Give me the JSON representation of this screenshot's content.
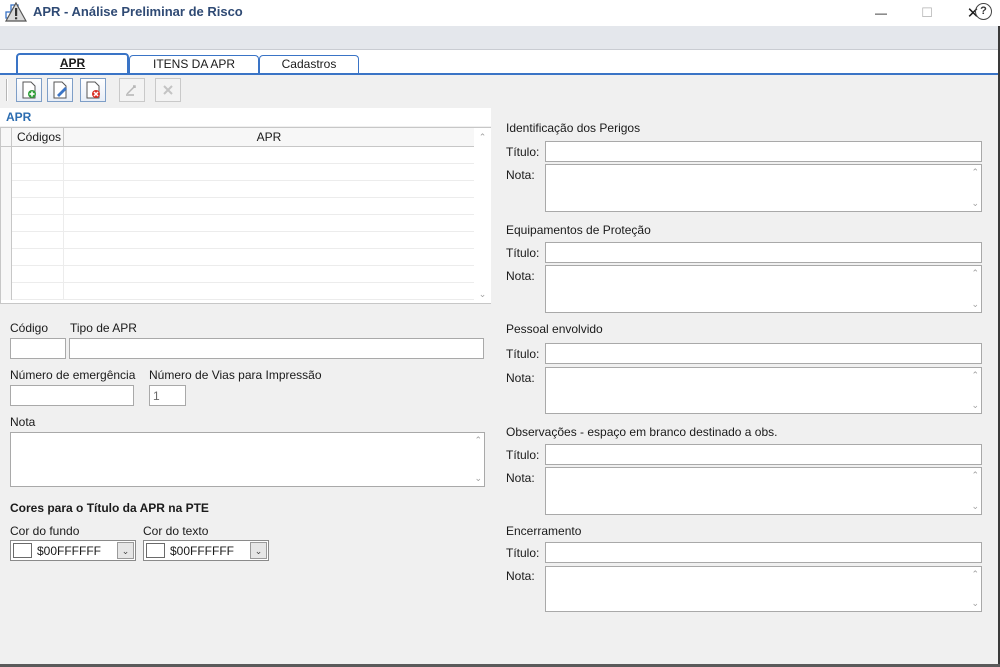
{
  "window": {
    "minimize_glyph": "—",
    "maximize_glyph": "☐",
    "close_glyph": "✕"
  },
  "header": {
    "title": "APR - Análise Preliminar de Risco",
    "help_glyph": "?"
  },
  "tabs": [
    {
      "label": "APR",
      "active": true
    },
    {
      "label": "ITENS DA APR",
      "active": false
    },
    {
      "label": "Cadastros",
      "active": false
    }
  ],
  "toolbar": {
    "buttons": [
      {
        "icon": "new-record-icon",
        "enabled": true
      },
      {
        "icon": "edit-record-icon",
        "enabled": true
      },
      {
        "icon": "delete-record-icon",
        "enabled": true
      },
      {
        "icon": "save-record-icon",
        "enabled": false
      },
      {
        "icon": "cancel-record-icon",
        "enabled": false
      }
    ]
  },
  "apr_group": {
    "heading": "APR",
    "columns": [
      "Códigos",
      "APR"
    ],
    "row_count": 9
  },
  "form": {
    "codigo_label": "Código",
    "codigo_value": "",
    "tipo_label": "Tipo de APR",
    "tipo_value": "",
    "emergencia_label": "Número de emergência",
    "emergencia_value": "",
    "vias_label": "Número de Vias para Impressão",
    "vias_value": "1",
    "nota_label": "Nota"
  },
  "cores": {
    "heading": "Cores para o Título da APR na PTE",
    "fundo_label": "Cor do fundo",
    "fundo_value": "$00FFFFFF",
    "texto_label": "Cor do texto",
    "texto_value": "$00FFFFFF"
  },
  "right_sections": [
    {
      "heading": "Identificação dos Perigos",
      "titulo_label": "Título:",
      "nota_label": "Nota:"
    },
    {
      "heading": "Equipamentos de Proteção",
      "titulo_label": "Título:",
      "nota_label": "Nota:"
    },
    {
      "heading": "Pessoal envolvido",
      "titulo_label": "Título:",
      "nota_label": "Nota:"
    },
    {
      "heading": "Observações - espaço em branco destinado a obs.",
      "titulo_label": "Título:",
      "nota_label": "Nota:"
    },
    {
      "heading": "Encerramento",
      "titulo_label": "Título:",
      "nota_label": "Nota:"
    }
  ],
  "colors": {
    "accent": "#3a74c6",
    "header_title": "#2f4a74",
    "section_heading": "#2b6cb0"
  }
}
